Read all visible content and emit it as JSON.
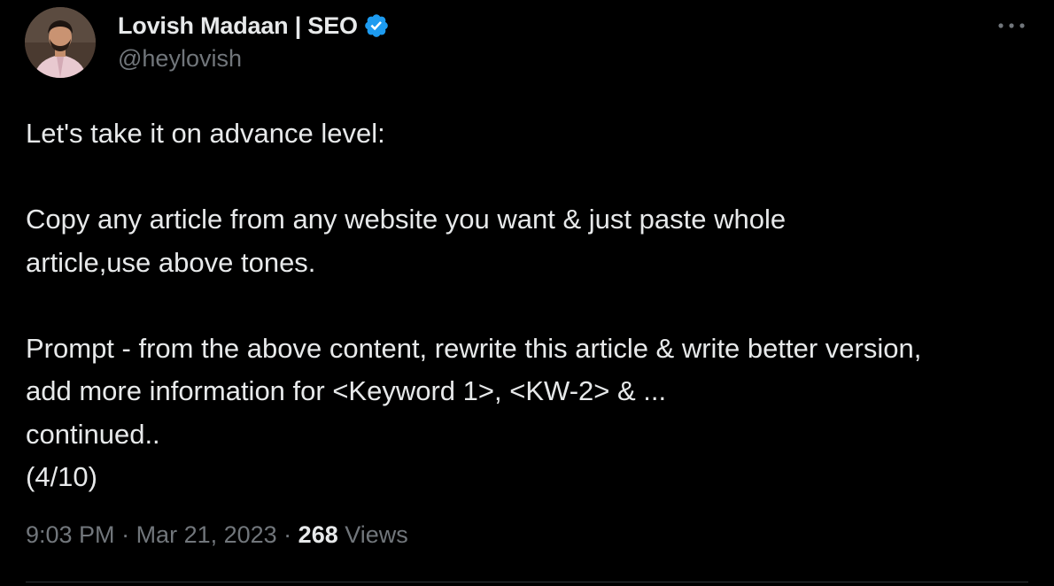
{
  "author": {
    "name": "Lovish Madaan | SEO",
    "handle": "@heylovish",
    "verified": true,
    "verified_color": "#1d9bf0"
  },
  "menu": {
    "more_icon": "more-horizontal-icon"
  },
  "tweet": {
    "paragraphs": [
      "Let's take it on advance level:",
      "Copy any article from any website you want & just paste whole article,use above tones.",
      "Prompt - from the above content, rewrite this article & write better version, add more information for <Keyword 1>, <KW-2> & ...\ncontinued..\n(4/10)"
    ]
  },
  "meta": {
    "time": "9:03 PM",
    "separator": " · ",
    "date": "Mar 21, 2023",
    "views_count": "268",
    "views_label": "Views"
  },
  "colors": {
    "background": "#000000",
    "primary_text": "#e7e9ea",
    "secondary_text": "#71767b",
    "divider": "#2f3336"
  }
}
